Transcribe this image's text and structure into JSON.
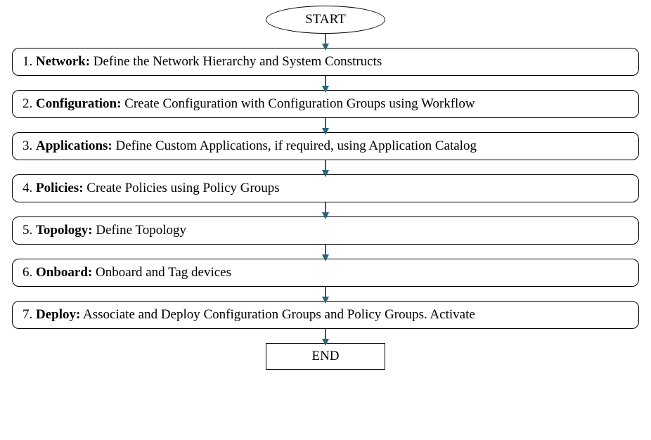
{
  "start": "START",
  "end": "END",
  "steps": [
    {
      "num": "1. ",
      "title": "Network:",
      "desc": "  Define the Network Hierarchy and System Constructs"
    },
    {
      "num": "2. ",
      "title": "Configuration:",
      "desc": "  Create Configuration with Configuration Groups using Workflow"
    },
    {
      "num": "3. ",
      "title": "Applications:",
      "desc": "  Define Custom Applications, if required, using Application Catalog"
    },
    {
      "num": "4. ",
      "title": "Policies:",
      "desc": "  Create Policies using Policy Groups"
    },
    {
      "num": "5. ",
      "title": "Topology:",
      "desc": "  Define Topology"
    },
    {
      "num": "6. ",
      "title": "Onboard:",
      "desc": "  Onboard and Tag devices"
    },
    {
      "num": "7. ",
      "title": "Deploy:",
      "desc": "  Associate and Deploy Configuration Groups and Policy Groups. Activate"
    }
  ],
  "arrow_color": "#2a6478"
}
